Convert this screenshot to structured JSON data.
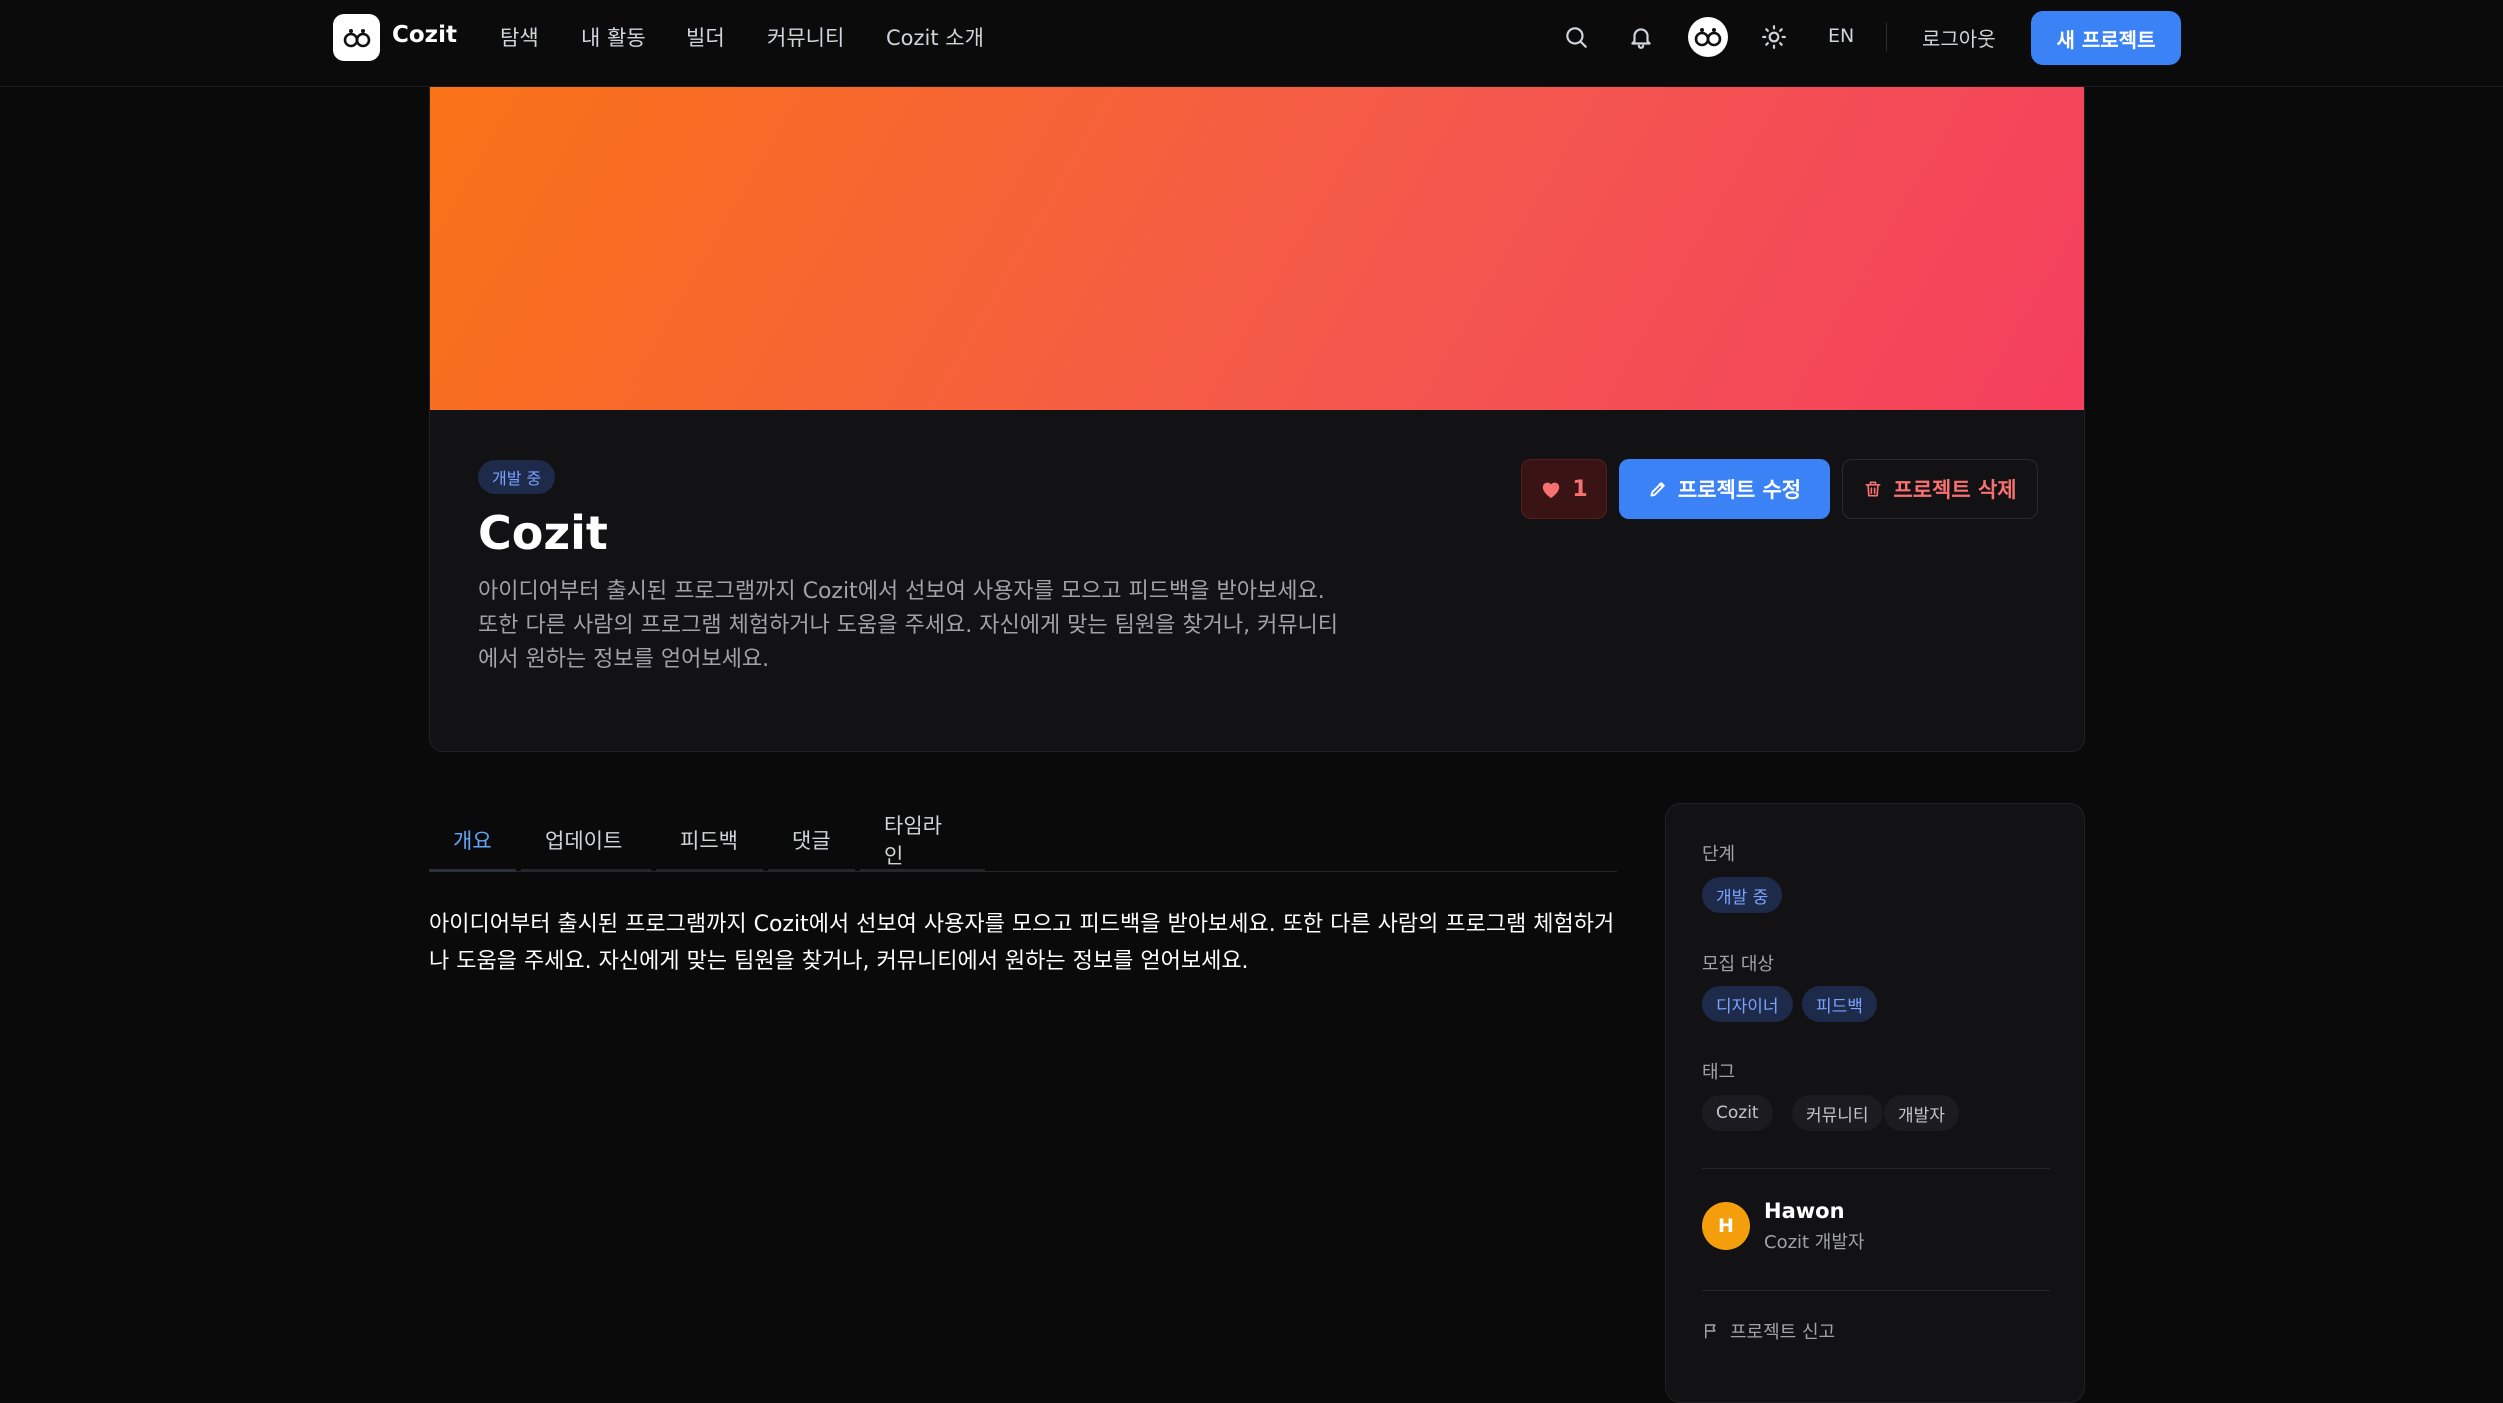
{
  "header": {
    "logo_text": "Cozit",
    "nav": [
      "탐색",
      "내 활동",
      "빌더",
      "커뮤니티",
      "Cozit 소개"
    ],
    "lang": "EN",
    "logout": "로그아웃",
    "new_project": "새 프로젝트",
    "icons": [
      "search-icon",
      "bell-icon",
      "profile-avatar",
      "sun-icon"
    ]
  },
  "project": {
    "stage_badge": "개발 중",
    "title": "Cozit",
    "description": "아이디어부터 출시된 프로그램까지 Cozit에서 선보여 사용자를 모으고 피드백을 받아보세요. 또한 다른 사람의 프로그램 체험하거나 도움을 주세요. 자신에게 맞는 팀원을 찾거나, 커뮤니티에서 원하는 정보를 얻어보세요.",
    "like_count": "1",
    "edit_label": "프로젝트 수정",
    "delete_label": "프로젝트 삭제",
    "banner_colors": [
      "#f97316",
      "#f43f5e"
    ]
  },
  "tabs": [
    "개요",
    "업데이트",
    "피드백",
    "댓글",
    "타임라인"
  ],
  "active_tab": "개요",
  "overview_text": "아이디어부터 출시된 프로그램까지 Cozit에서 선보여 사용자를 모으고 피드백을 받아보세요. 또한 다른 사람의 프로그램 체험하거나 도움을 주세요. 자신에게 맞는 팀원을 찾거나, 커뮤니티에서 원하는 정보를 얻어보세요.",
  "sidebar": {
    "stage_label": "단계",
    "stage_value": "개발 중",
    "recruit_label": "모집 대상",
    "recruit": [
      "디자이너",
      "피드백"
    ],
    "tags_label": "태그",
    "tags": [
      "Cozit",
      "커뮤니티",
      "개발자"
    ],
    "owner": {
      "initial": "H",
      "name": "Hawon",
      "role": "Cozit 개발자"
    },
    "report": "프로젝트 신고"
  },
  "colors": {
    "accent": "#3b82f6",
    "danger": "#f87171",
    "background": "#0a0a0b"
  }
}
